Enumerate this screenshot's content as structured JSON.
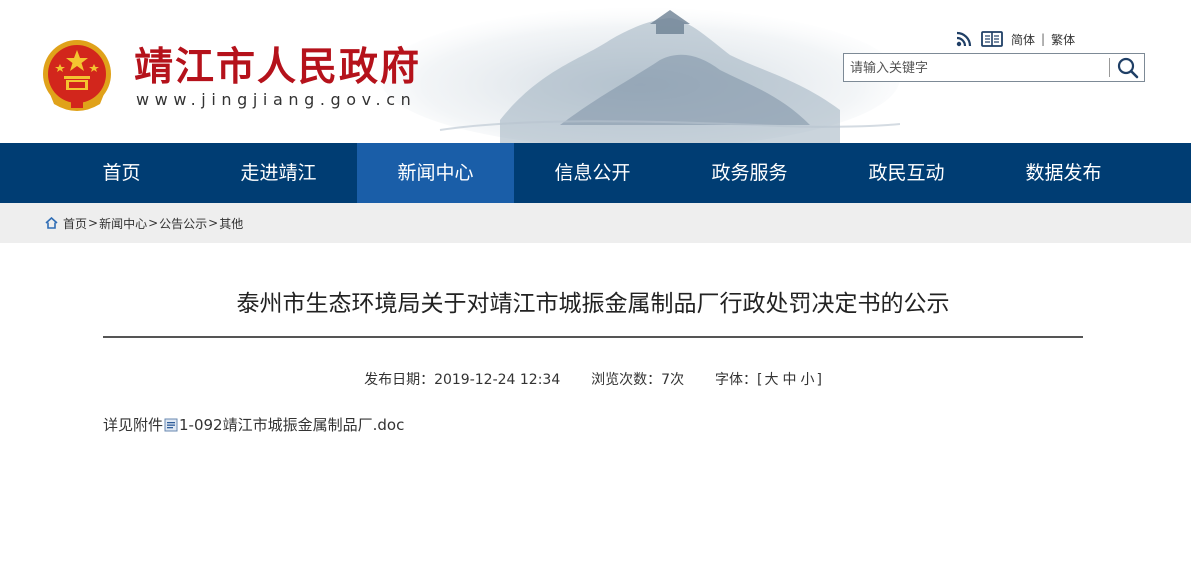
{
  "header": {
    "site_name": "靖江市人民政府",
    "site_domain": "www.jingjiang.gov.cn",
    "icons": [
      "national-emblem-icon",
      "rss-icon",
      "reader-icon",
      "search-icon",
      "home-icon",
      "doc-file-icon"
    ],
    "lang_simplified": "简体",
    "lang_separator": "|",
    "lang_traditional": "繁体",
    "search_placeholder": "请输入关键字"
  },
  "nav": {
    "items": [
      {
        "label": "首页"
      },
      {
        "label": "走进靖江"
      },
      {
        "label": "新闻中心",
        "active": true
      },
      {
        "label": "信息公开"
      },
      {
        "label": "政务服务"
      },
      {
        "label": "政民互动"
      },
      {
        "label": "数据发布"
      }
    ]
  },
  "breadcrumb": {
    "items": [
      "首页",
      "新闻中心",
      "公告公示",
      "其他"
    ],
    "separator": ">"
  },
  "article": {
    "title": "泰州市生态环境局关于对靖江市城振金属制品厂行政处罚决定书的公示",
    "date_label": "发布日期：",
    "date": "2019-12-24 12:34",
    "views_label": "浏览次数：",
    "views": "7次",
    "font_label": "字体：",
    "font_open": "[",
    "font_large": "大",
    "font_medium": "中",
    "font_small": "小",
    "font_close": "]",
    "body_prefix": "详见附件",
    "attachment_name": "1-092靖江市城振金属制品厂.doc"
  },
  "colors": {
    "nav_bg": "#003d73",
    "nav_active": "#1a5ea8",
    "site_name": "#b5121b",
    "crumb_bg": "#eeeeee"
  }
}
